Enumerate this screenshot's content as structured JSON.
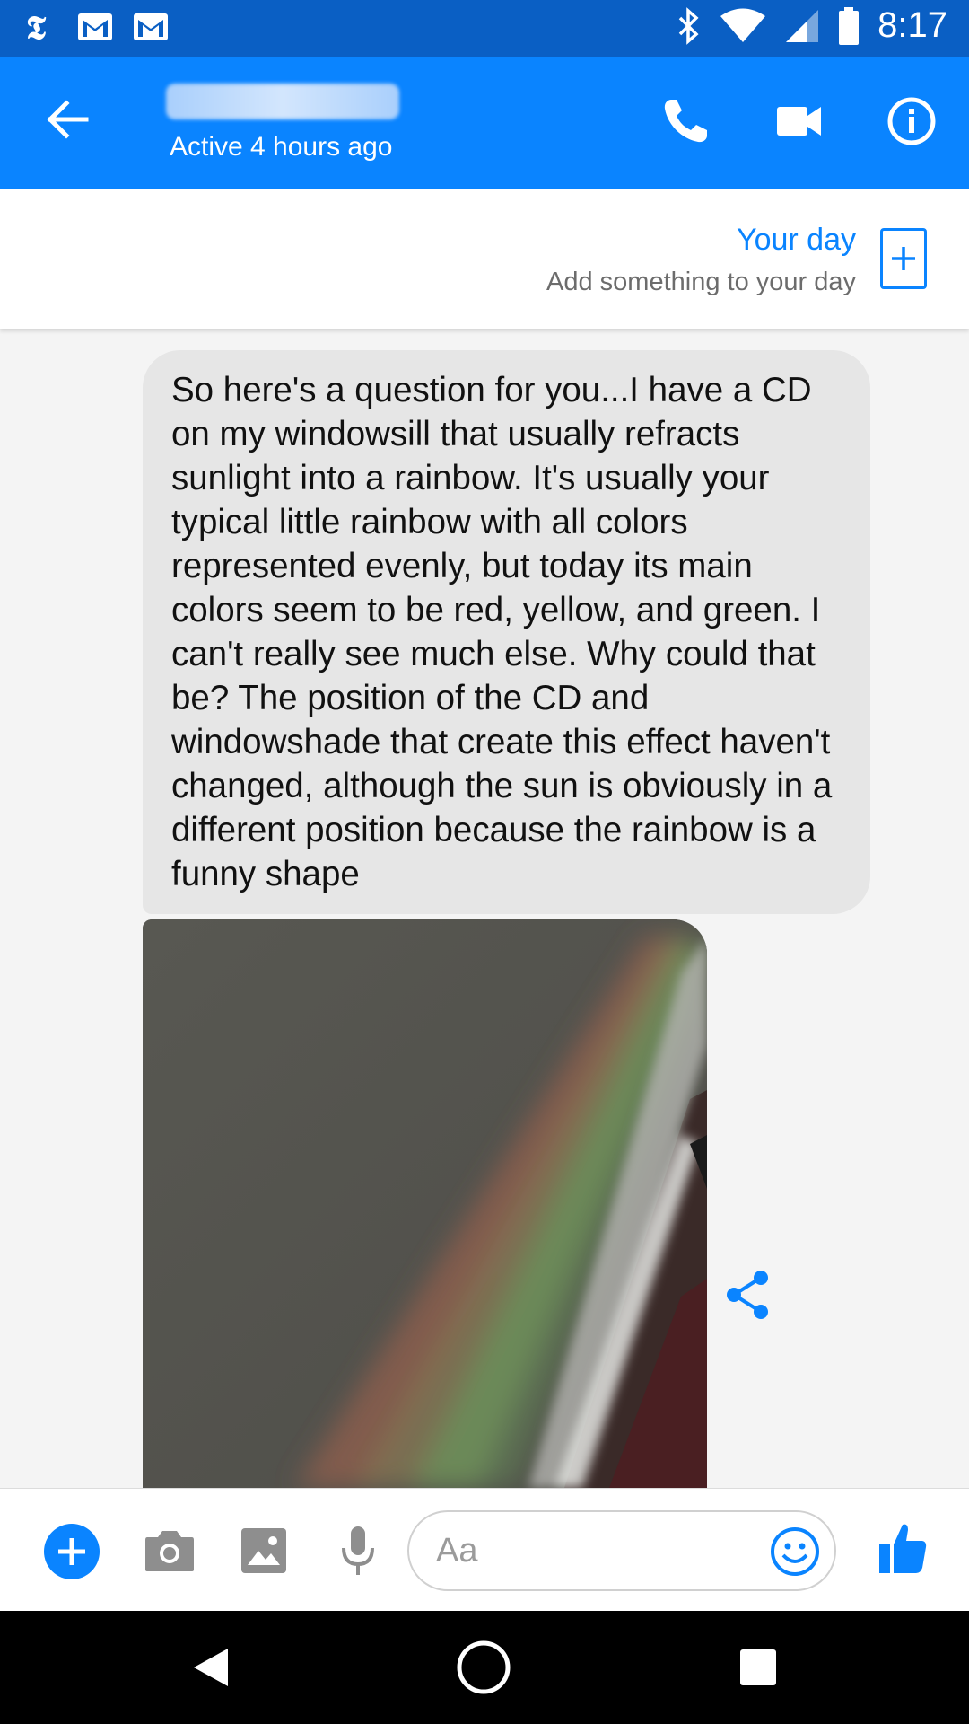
{
  "status_bar": {
    "time": "8:17",
    "left_icons": [
      "nytimes-icon",
      "gmail-icon",
      "gmail-icon"
    ],
    "right_icons": [
      "bluetooth-icon",
      "wifi-icon",
      "signal-icon",
      "battery-icon"
    ]
  },
  "header": {
    "active_status": "Active 4 hours ago",
    "icons": [
      "back-arrow-icon",
      "phone-icon",
      "video-camera-icon",
      "info-icon"
    ]
  },
  "your_day": {
    "title": "Your day",
    "subtitle": "Add something to your day",
    "icon": "plus-icon"
  },
  "conversation": {
    "messages": [
      {
        "text": "So here's a question for you...I have a CD on my windowsill that usually refracts sunlight into a rainbow. It's usually your typical little rainbow with all colors represented evenly, but today its main colors seem to be red, yellow, and green. I can't really see much else. Why could that be? The position of the CD and windowshade that create this effect haven't changed, although the sun is obviously in a different position because the rainbow is a funny shape"
      }
    ],
    "attachment_icon": "share-icon"
  },
  "composer": {
    "placeholder": "Aa",
    "icons": [
      "plus-circle-icon",
      "camera-icon",
      "image-icon",
      "microphone-icon",
      "emoji-icon",
      "thumbs-up-icon"
    ]
  },
  "colors": {
    "status_bar": "#0a5fc4",
    "app_bar": "#0a84ff",
    "accent": "#0a84ff",
    "bubble": "#e6e6e6"
  }
}
